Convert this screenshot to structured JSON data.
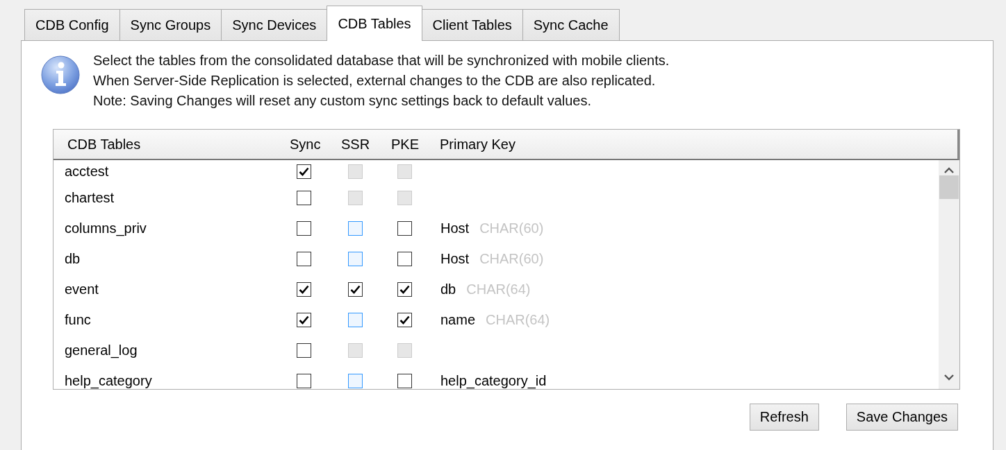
{
  "tabs": [
    {
      "label": "CDB Config",
      "selected": false
    },
    {
      "label": "Sync Groups",
      "selected": false
    },
    {
      "label": "Sync Devices",
      "selected": false
    },
    {
      "label": "CDB Tables",
      "selected": true
    },
    {
      "label": "Client Tables",
      "selected": false
    },
    {
      "label": "Sync Cache",
      "selected": false
    }
  ],
  "info": {
    "lines": [
      "Select the tables from the consolidated database that will be synchronized with mobile clients.",
      "When Server-Side Replication is selected, external changes to the CDB are also replicated.",
      "Note: Saving Changes will reset any custom sync settings back to default values."
    ]
  },
  "table": {
    "columns": [
      "CDB Tables",
      "Sync",
      "SSR",
      "PKE",
      "Primary Key"
    ],
    "rows": [
      {
        "name": "acctest",
        "sync": {
          "checked": true,
          "disabled": false
        },
        "ssr": {
          "checked": false,
          "disabled": true
        },
        "pke": {
          "checked": false,
          "disabled": true
        }
      },
      {
        "name": "chartest",
        "sync": {
          "checked": false,
          "disabled": false
        },
        "ssr": {
          "checked": false,
          "disabled": true
        },
        "pke": {
          "checked": false,
          "disabled": true
        }
      },
      {
        "name": "columns_priv",
        "sync": {
          "checked": false,
          "disabled": false
        },
        "ssr": {
          "checked": false,
          "disabled": false
        },
        "pke": {
          "checked": false,
          "disabled": false
        },
        "key": "Host",
        "key_type": "CHAR(60)"
      },
      {
        "name": "db",
        "sync": {
          "checked": false,
          "disabled": false
        },
        "ssr": {
          "checked": false,
          "disabled": false
        },
        "pke": {
          "checked": false,
          "disabled": false
        },
        "key": "Host",
        "key_type": "CHAR(60)"
      },
      {
        "name": "event",
        "sync": {
          "checked": true,
          "disabled": false
        },
        "ssr": {
          "checked": true,
          "disabled": false
        },
        "pke": {
          "checked": true,
          "disabled": false
        },
        "key": "db",
        "key_type": "CHAR(64)"
      },
      {
        "name": "func",
        "sync": {
          "checked": true,
          "disabled": false
        },
        "ssr": {
          "checked": false,
          "disabled": false
        },
        "pke": {
          "checked": true,
          "disabled": false
        },
        "key": "name",
        "key_type": "CHAR(64)"
      },
      {
        "name": "general_log",
        "sync": {
          "checked": false,
          "disabled": false
        },
        "ssr": {
          "checked": false,
          "disabled": true
        },
        "pke": {
          "checked": false,
          "disabled": true
        }
      },
      {
        "name": "help_category",
        "sync": {
          "checked": false,
          "disabled": false
        },
        "ssr": {
          "checked": false,
          "disabled": false
        },
        "pke": {
          "checked": false,
          "disabled": false
        },
        "key": "help_category_id"
      }
    ]
  },
  "buttons": [
    "Refresh",
    "Save Changes"
  ]
}
